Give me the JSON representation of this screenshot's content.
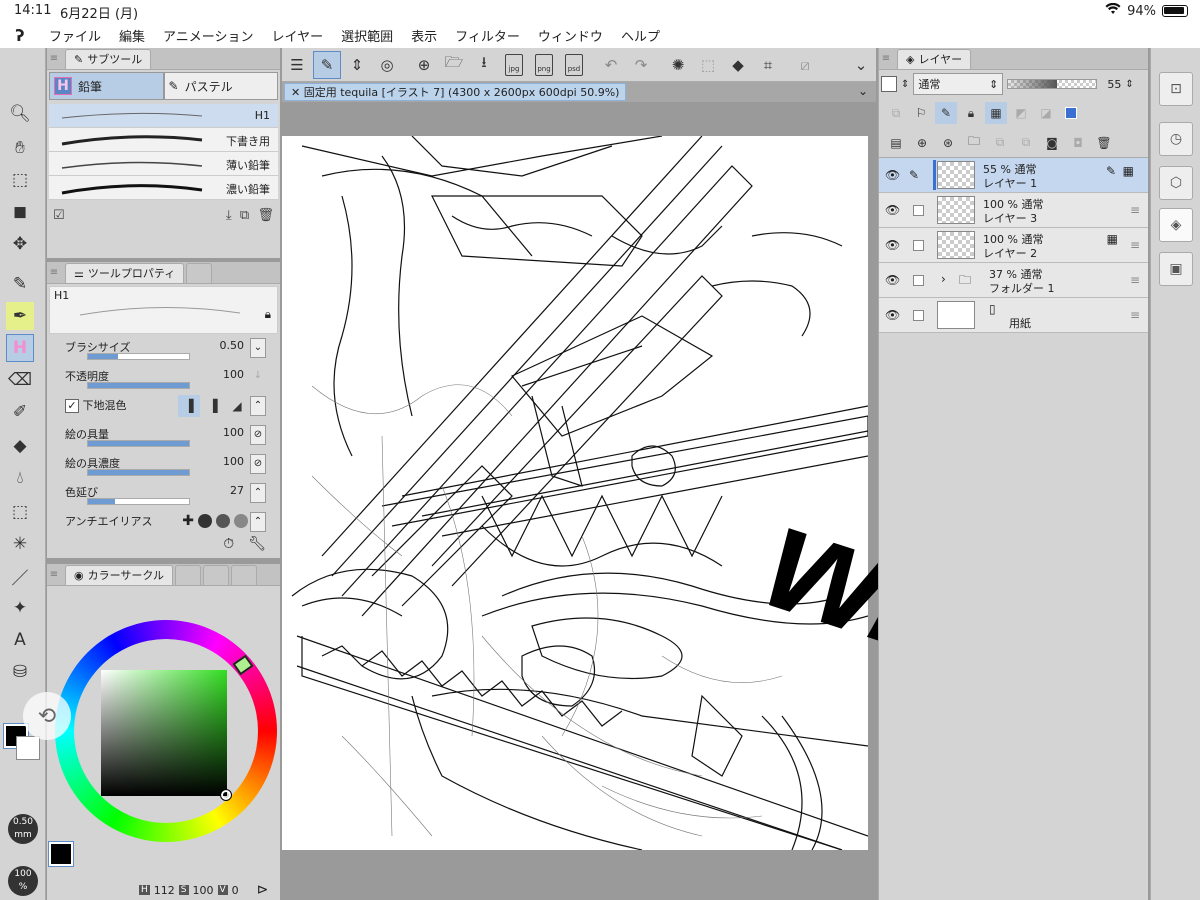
{
  "status": {
    "time": "14:11",
    "date": "6月22日 (月)",
    "battery": "94%"
  },
  "menu": [
    "ファイル",
    "編集",
    "アニメーション",
    "レイヤー",
    "選択範囲",
    "表示",
    "フィルター",
    "ウィンドウ",
    "ヘルプ"
  ],
  "subtool": {
    "title": "サブツール",
    "tabs": [
      "鉛筆",
      "パステル"
    ],
    "brushes": [
      "H1",
      "下書き用",
      "薄い鉛筆",
      "濃い鉛筆"
    ]
  },
  "toolprop": {
    "title": "ツールプロパティ",
    "preset": "H1",
    "props": [
      {
        "label": "ブラシサイズ",
        "value": "0.50",
        "fill": 0.3
      },
      {
        "label": "不透明度",
        "value": "100",
        "fill": 1.0
      },
      {
        "label": "下地混色",
        "value": "",
        "fill": 0
      },
      {
        "label": "絵の具量",
        "value": "100",
        "fill": 1.0
      },
      {
        "label": "絵の具濃度",
        "value": "100",
        "fill": 1.0
      },
      {
        "label": "色延び",
        "value": "27",
        "fill": 0.27
      },
      {
        "label": "アンチエイリアス",
        "value": "",
        "fill": 0
      }
    ]
  },
  "color": {
    "title": "カラーサークル",
    "h": "112",
    "s": "100",
    "v": "0",
    "brush_size": "0.50",
    "brush_unit": "mm",
    "zoom": "100",
    "zoom_unit": "%",
    "main_color": "#000000",
    "hue_square_color": "#33dd22"
  },
  "canvas": {
    "tab_title": "固定用 tequila [イラスト 7] (4300 x 2600px 600dpi 50.9%)",
    "overlay_text": "wip"
  },
  "layers": {
    "title": "レイヤー",
    "blend_mode": "通常",
    "opacity": "55",
    "opacity_fill": 0.55,
    "items": [
      {
        "opacity": "55 %",
        "mode": "通常",
        "name": "レイヤー 1",
        "active": true
      },
      {
        "opacity": "100 %",
        "mode": "通常",
        "name": "レイヤー 3",
        "active": false
      },
      {
        "opacity": "100 %",
        "mode": "通常",
        "name": "レイヤー 2",
        "active": false
      },
      {
        "opacity": "37 %",
        "mode": "通常",
        "name": "フォルダー 1",
        "active": false
      },
      {
        "opacity": "",
        "mode": "",
        "name": "用紙",
        "active": false
      }
    ]
  }
}
